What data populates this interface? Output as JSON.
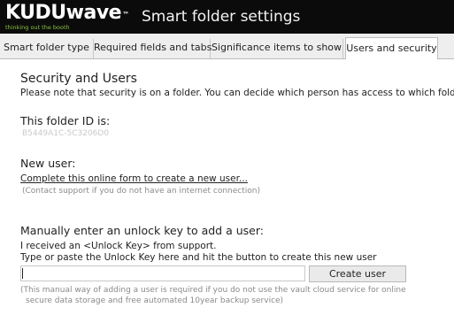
{
  "app": {
    "logo_text": "KUDUwave",
    "logo_mark": "™",
    "tagline": "thinking out the booth",
    "window_title": "Smart folder settings"
  },
  "tabs": [
    {
      "label": "Smart folder type",
      "active": false
    },
    {
      "label": "Required fields and tabs",
      "active": false
    },
    {
      "label": "Significance items to show",
      "active": false
    },
    {
      "label": "Users and security",
      "active": true
    }
  ],
  "security": {
    "heading": "Security and Users",
    "note": "Please note that security is on a folder. You can decide which person has access to which folder.",
    "folder_id_label": "This folder ID is:",
    "folder_id_value": "B5449A1C-5C3206D0",
    "new_user_label": "New user:",
    "new_user_link": "Complete this online form to create a new user...",
    "new_user_hint": "(Contact support if you do not have an internet connection)",
    "manual_heading": "Manually enter an unlock key to add a user:",
    "manual_line1": "I received an <Unlock Key> from support.",
    "manual_line2": "Type or paste the Unlock Key here and hit the button to create this new user",
    "unlock_key_value": "",
    "create_button": "Create user",
    "manual_note_line1": "(This manual way of adding a user is required if you do not use the vault cloud service for online",
    "manual_note_line2": "secure data storage and free automated 10year backup service)"
  },
  "colors": {
    "titlebar_bg": "#0b0b0b",
    "tagline": "#8cc63e"
  }
}
